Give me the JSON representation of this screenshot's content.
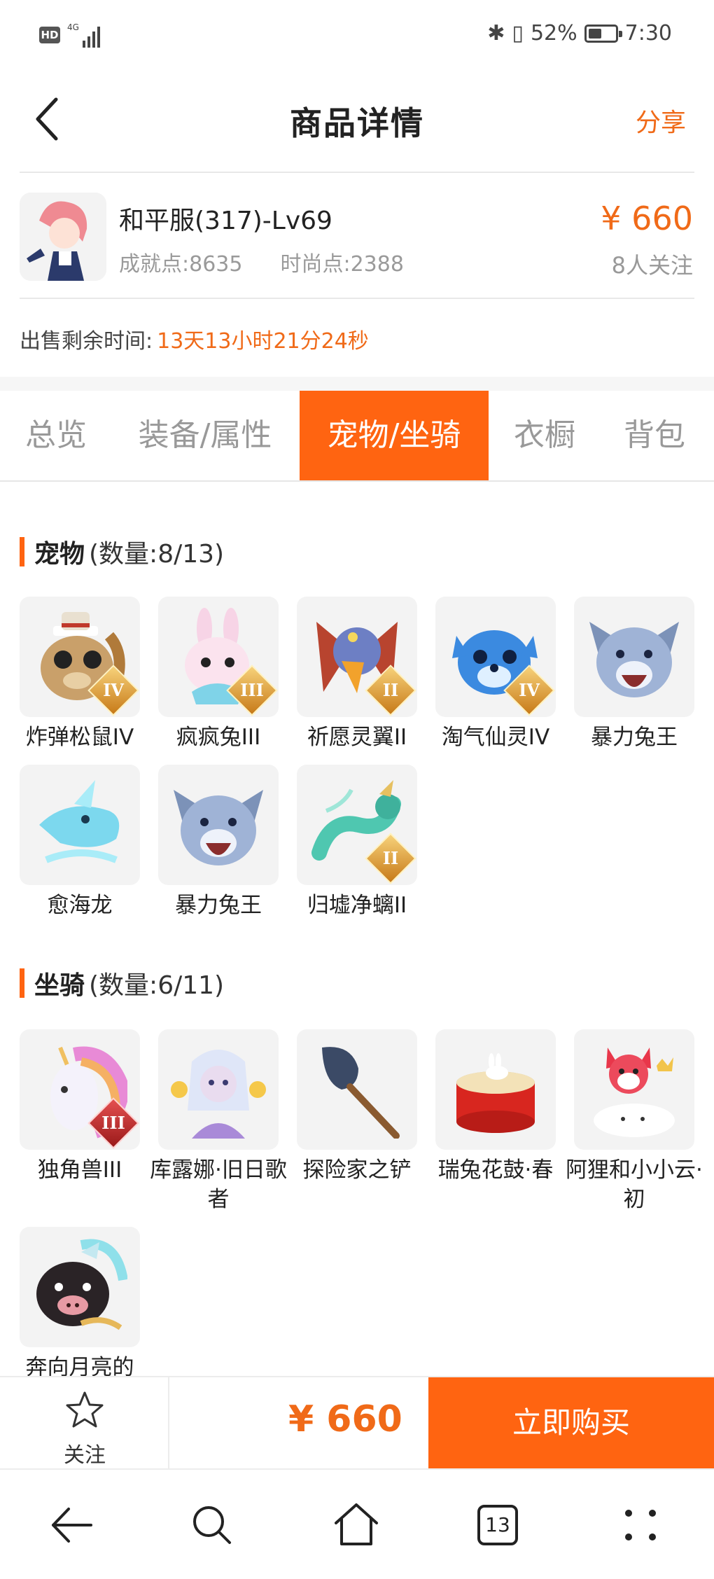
{
  "status_bar": {
    "hd": "HD",
    "net": "4G",
    "battery": "52%",
    "battery_level": 0.52,
    "time": "7:30"
  },
  "header": {
    "title": "商品详情",
    "share": "分享"
  },
  "product": {
    "name": "和平服(317)-Lv69",
    "achievement": "成就点:8635",
    "fashion": "时尚点:2388",
    "price": "¥ 660",
    "followers": "8人关注",
    "remain_label": "出售剩余时间:",
    "remain_value": "13天13小时21分24秒"
  },
  "tabs": [
    {
      "label": "总览",
      "active": false
    },
    {
      "label": "装备/属性",
      "active": false
    },
    {
      "label": "宠物/坐骑",
      "active": true
    },
    {
      "label": "衣橱",
      "active": false
    },
    {
      "label": "背包",
      "active": false
    }
  ],
  "pets": {
    "title": "宠物",
    "count": "(数量:8/13)",
    "items": [
      {
        "name": "炸弹松鼠IV",
        "badge": "IV"
      },
      {
        "name": "疯疯兔III",
        "badge": "III"
      },
      {
        "name": "祈愿灵翼II",
        "badge": "II"
      },
      {
        "name": "淘气仙灵IV",
        "badge": "IV"
      },
      {
        "name": "暴力兔王",
        "badge": ""
      },
      {
        "name": "愈海龙",
        "badge": ""
      },
      {
        "name": "暴力兔王",
        "badge": ""
      },
      {
        "name": "归墟净螭II",
        "badge": "II"
      }
    ]
  },
  "mounts": {
    "title": "坐骑",
    "count": "(数量:6/11)",
    "items": [
      {
        "name": "独角兽III",
        "badge": "III"
      },
      {
        "name": "库露娜·旧日歌者",
        "badge": ""
      },
      {
        "name": "探险家之铲",
        "badge": ""
      },
      {
        "name": "瑞兔花鼓·春",
        "badge": ""
      },
      {
        "name": "阿狸和小小云·初",
        "badge": ""
      },
      {
        "name": "奔向月亮的",
        "badge": ""
      }
    ]
  },
  "action_bar": {
    "follow": "关注",
    "price": "¥ 660",
    "buy": "立即购买"
  },
  "colors": {
    "accent": "#ff6411",
    "price": "#f06a18"
  },
  "nav": {
    "tabs_count": "13"
  }
}
